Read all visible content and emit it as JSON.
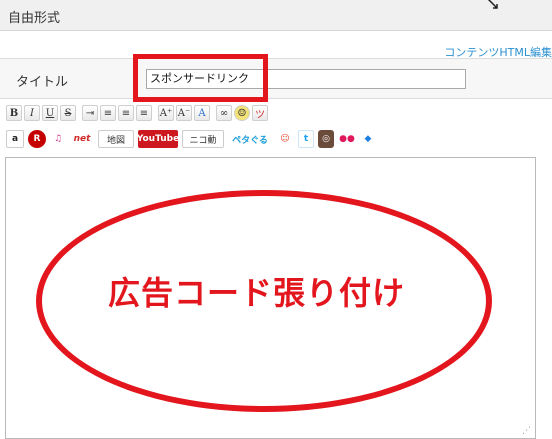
{
  "panel": {
    "title": "自由形式"
  },
  "editor_link": "コンテンツHTML編集",
  "form": {
    "label": "タイトル",
    "value": "スポンサードリンク"
  },
  "toolbar": {
    "row1": [
      {
        "name": "bold-button",
        "glyph": "B"
      },
      {
        "name": "italic-button",
        "glyph": "I"
      },
      {
        "name": "underline-button",
        "glyph": "U"
      },
      {
        "name": "strikethrough-button",
        "glyph": "S"
      },
      {
        "name": "indent-button",
        "glyph": "⇥"
      },
      {
        "name": "align-left-button",
        "glyph": "≡"
      },
      {
        "name": "align-center-button",
        "glyph": "≡"
      },
      {
        "name": "align-right-button",
        "glyph": "≡"
      },
      {
        "name": "font-size-increase-button",
        "glyph": "A⁺"
      },
      {
        "name": "font-size-decrease-button",
        "glyph": "A⁻"
      },
      {
        "name": "font-color-button",
        "glyph": "A"
      },
      {
        "name": "link-button",
        "glyph": "∞"
      },
      {
        "name": "emoji-button",
        "glyph": "☺"
      },
      {
        "name": "kaomoji-button",
        "glyph": "ツ"
      }
    ],
    "row2": [
      {
        "name": "amazon-button",
        "glyph": "a"
      },
      {
        "name": "rakuten-button",
        "glyph": "R"
      },
      {
        "name": "music-button",
        "glyph": "♫"
      },
      {
        "name": "ameba-net-button",
        "glyph": "net"
      },
      {
        "name": "map-button",
        "glyph": "地図"
      },
      {
        "name": "youtube-button",
        "glyph": "YouTube"
      },
      {
        "name": "niconico-button",
        "glyph": "ニコ動"
      },
      {
        "name": "petagogu-button",
        "glyph": "ペタぐる"
      },
      {
        "name": "ameba-pigg-button",
        "glyph": "☺"
      },
      {
        "name": "twitter-button",
        "glyph": "t"
      },
      {
        "name": "instagram-button",
        "glyph": "◎"
      },
      {
        "name": "flickr-button",
        "glyph": "●●"
      },
      {
        "name": "dropbox-button",
        "glyph": "◆"
      }
    ]
  },
  "annotation": "広告コード張り付け",
  "colors": {
    "annotation_red": "#e3161e",
    "link_blue": "#2a8fd0"
  }
}
